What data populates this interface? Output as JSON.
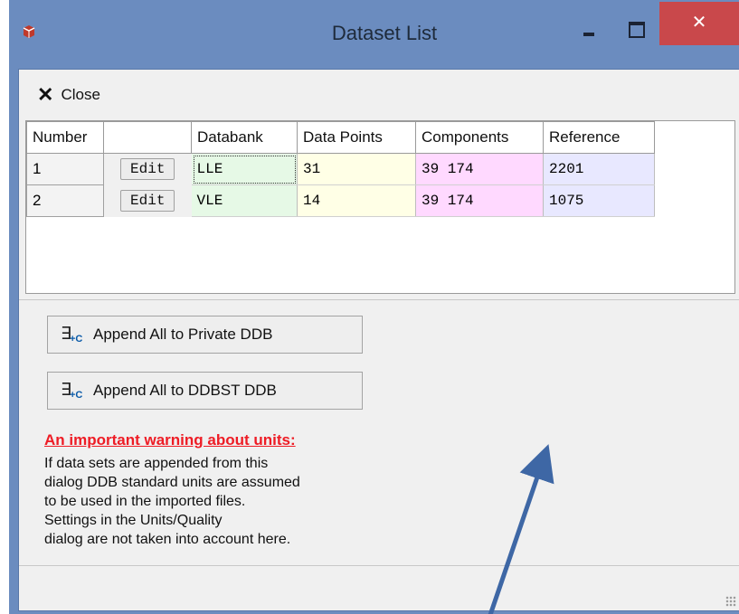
{
  "window": {
    "title": "Dataset List",
    "close_symbol": "✕"
  },
  "toolbar": {
    "close_label": "Close"
  },
  "grid": {
    "columns": [
      "Number",
      "",
      "Databank",
      "Data Points",
      "Components",
      "Reference"
    ],
    "rows": [
      {
        "number": "1",
        "edit": "Edit",
        "databank": "LLE",
        "data_points": "31",
        "components": "39 174",
        "reference": "2201"
      },
      {
        "number": "2",
        "edit": "Edit",
        "databank": "VLE",
        "data_points": "14",
        "components": "39 174",
        "reference": "1075"
      }
    ],
    "colors": {
      "databank": "#e6f9e6",
      "data_points": "#ffffe6",
      "components": "#ffd9ff",
      "reference": "#e8e8ff"
    }
  },
  "buttons": {
    "append_private": "Append All to Private DDB",
    "append_ddbst": "Append All to DDBST DDB"
  },
  "warning": {
    "title": "An important warning about units:",
    "lines": [
      "If data sets are appended from this",
      "dialog DDB standard units are assumed",
      "to be used in the imported files.",
      "Settings in the Units/Quality",
      "dialog are not taken into account here."
    ],
    "color": "#ee1c25"
  },
  "annotation": {
    "arrow_color": "#3e67a5"
  }
}
